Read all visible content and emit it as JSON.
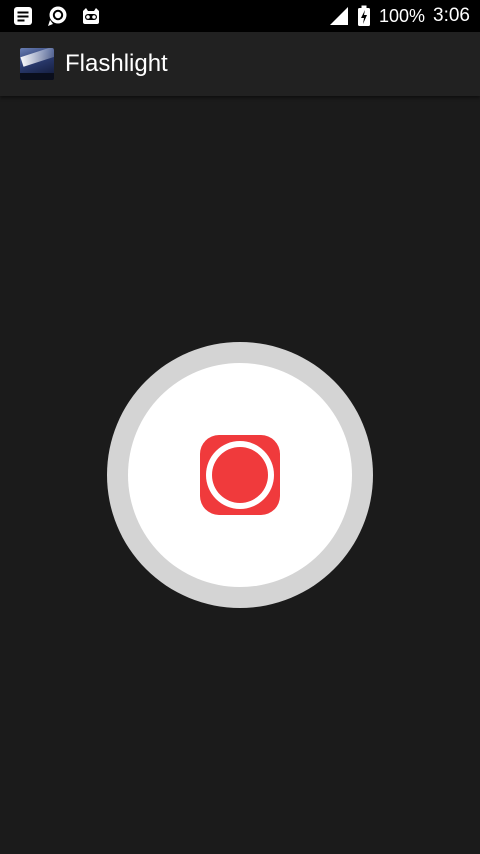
{
  "status_bar": {
    "notification_icons": [
      "message-icon",
      "chat-search-icon",
      "cyanogen-mascot-icon"
    ],
    "signal_icon": "cell-signal-icon",
    "battery_icon": "battery-charging-icon",
    "battery_text": "100%",
    "time": "3:06"
  },
  "action_bar": {
    "app_icon": "flashlight-app-icon",
    "title": "Flashlight"
  },
  "main": {
    "toggle_icon": "record-icon",
    "toggle_state": "off"
  },
  "colors": {
    "background": "#1b1b1b",
    "status_bar": "#000000",
    "action_bar": "#212121",
    "button_ring": "#d4d4d4",
    "button_face": "#ffffff",
    "accent_red": "#f03a3c"
  }
}
